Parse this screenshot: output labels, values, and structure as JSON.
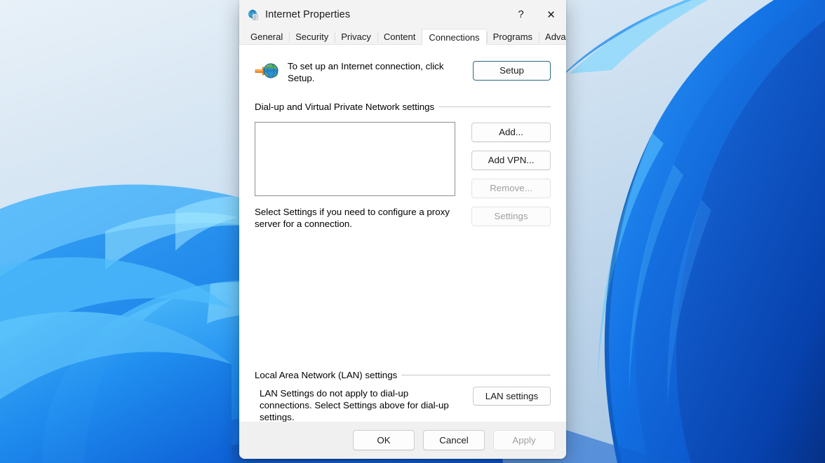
{
  "window": {
    "title": "Internet Properties",
    "icon": "internet-properties-icon",
    "help_label": "?",
    "close_label": "✕"
  },
  "tabs": [
    {
      "label": "General",
      "active": false
    },
    {
      "label": "Security",
      "active": false
    },
    {
      "label": "Privacy",
      "active": false
    },
    {
      "label": "Content",
      "active": false
    },
    {
      "label": "Connections",
      "active": true
    },
    {
      "label": "Programs",
      "active": false
    },
    {
      "label": "Advanced",
      "active": false
    }
  ],
  "connections": {
    "setup": {
      "icon": "internet-connection-globe-icon",
      "text": "To set up an Internet connection, click Setup.",
      "button_label": "Setup"
    },
    "dialup_group": {
      "caption": "Dial-up and Virtual Private Network settings",
      "list_items": [],
      "buttons": [
        {
          "label": "Add...",
          "disabled": false
        },
        {
          "label": "Add VPN...",
          "disabled": false
        },
        {
          "label": "Remove...",
          "disabled": true
        },
        {
          "label": "Settings",
          "disabled": true
        }
      ],
      "hint": "Select Settings if you need to configure a proxy server for a connection."
    },
    "lan_group": {
      "caption": "Local Area Network (LAN) settings",
      "text": "LAN Settings do not apply to dial-up connections. Select Settings above for dial-up settings.",
      "button_label": "LAN settings"
    }
  },
  "footer": {
    "ok_label": "OK",
    "cancel_label": "Cancel",
    "apply_label": "Apply",
    "apply_disabled": true
  },
  "colors": {
    "default_button_border": "#2b6a7d",
    "dialog_bg": "#f0f0f0",
    "page_bg": "#ffffff",
    "disabled_text": "#a0a0a0"
  }
}
